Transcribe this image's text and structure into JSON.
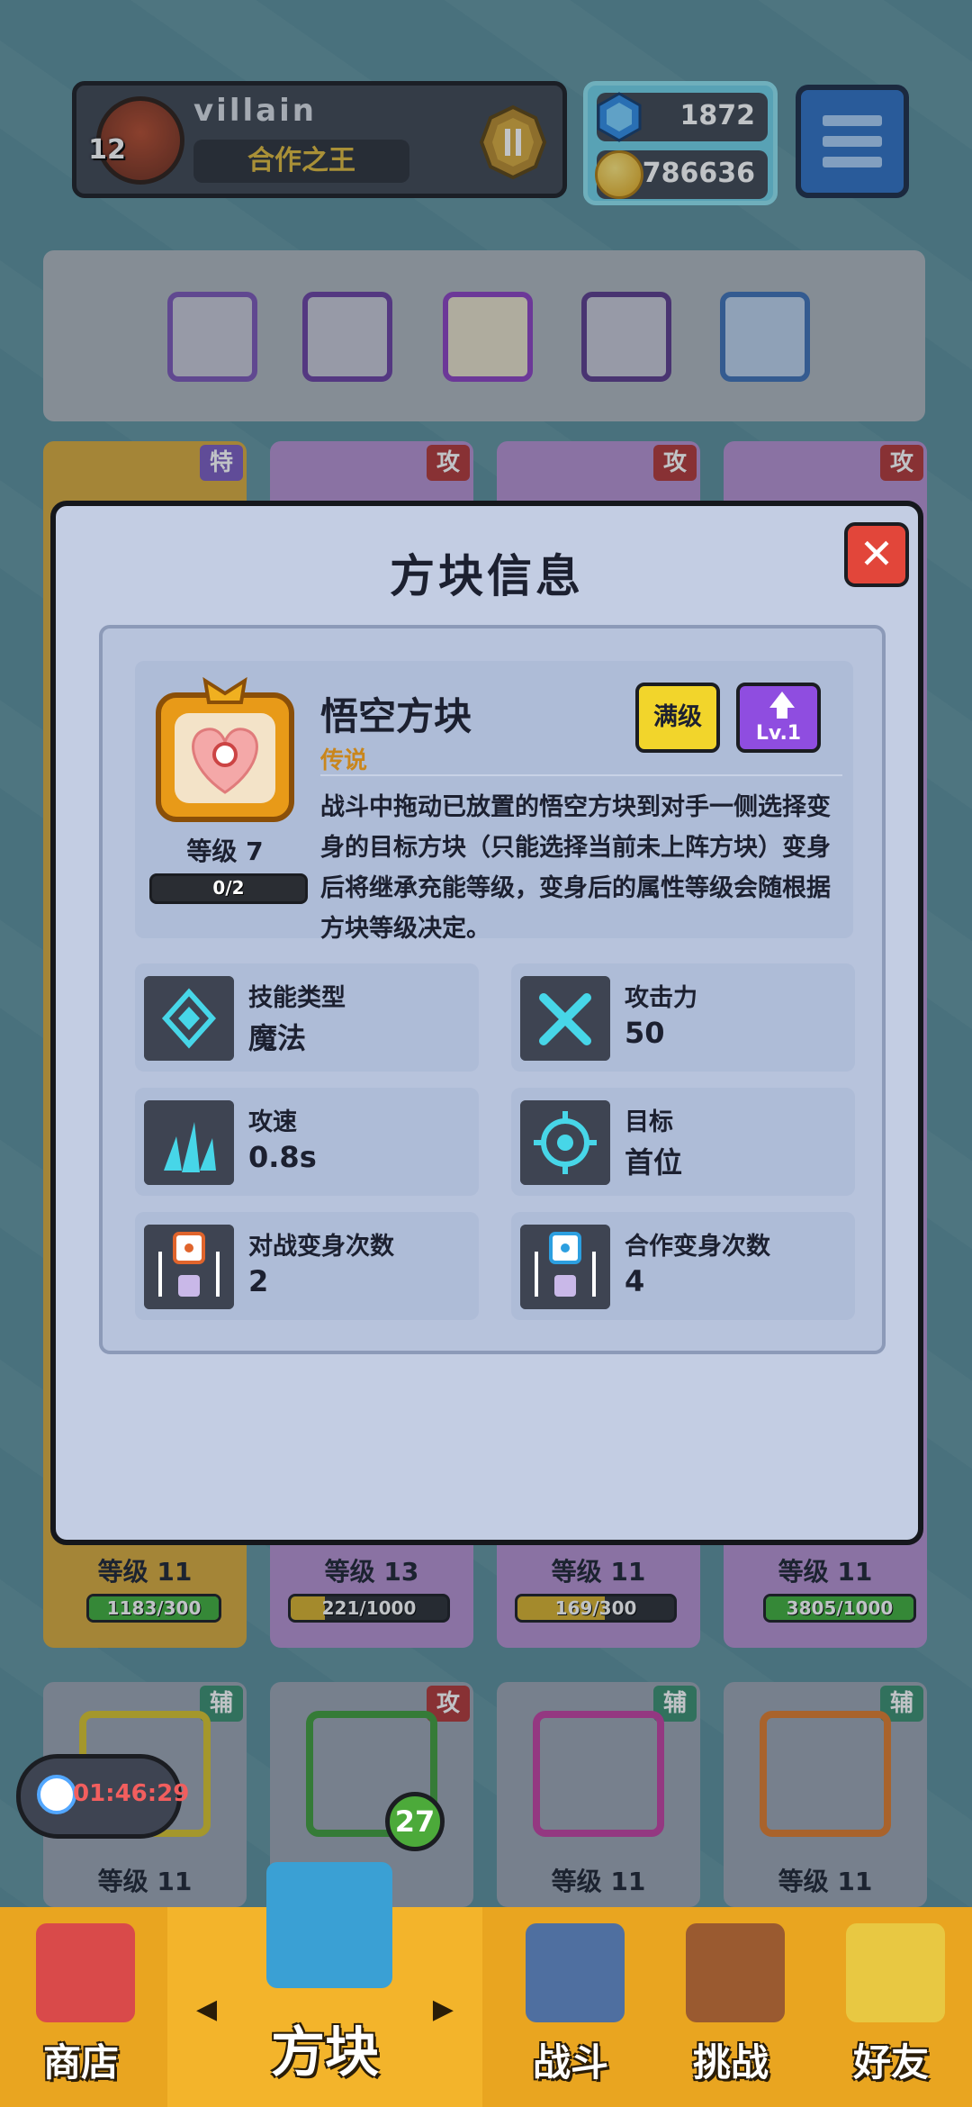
{
  "profile": {
    "username": "villain",
    "level": "12",
    "title": "合作之王",
    "rank_icon": "rank-roman-ii-icon"
  },
  "currency": {
    "gems": "1872",
    "coins": "786636"
  },
  "background_cards": {
    "row1_tags": [
      "特",
      "攻",
      "攻",
      "攻"
    ],
    "row1_levels": [
      "等级 11",
      "等级 13",
      "等级 11",
      "等级 11"
    ],
    "row1_progress": [
      "1183/300",
      "221/1000",
      "169/300",
      "3805/1000"
    ],
    "row2_tags": [
      "辅",
      "攻",
      "辅",
      "辅"
    ],
    "row2_levels": [
      "等级 11",
      "",
      "等级 11",
      "等级 11"
    ]
  },
  "modal": {
    "title": "方块信息",
    "close_label": "✕",
    "block": {
      "name": "悟空方块",
      "rarity": "传说",
      "level_label": "等级 7",
      "progress": "0/2",
      "max_button": "满级",
      "level_button": "Lv.1",
      "description": "战斗中拖动已放置的悟空方块到对手一侧选择变身的目标方块（只能选择当前未上阵方块）变身后将继承充能等级，变身后的属性等级会随根据方块等级决定。"
    },
    "stats": [
      {
        "label": "技能类型",
        "value": "魔法",
        "icon": "skill-type-icon"
      },
      {
        "label": "攻击力",
        "value": "50",
        "icon": "crossed-swords-icon"
      },
      {
        "label": "攻速",
        "value": "0.8s",
        "icon": "attack-speed-icon"
      },
      {
        "label": "目标",
        "value": "首位",
        "icon": "target-icon"
      },
      {
        "label": "对战变身次数",
        "value": "2",
        "icon": "transform-battle-icon"
      },
      {
        "label": "合作变身次数",
        "value": "4",
        "icon": "transform-coop-icon"
      }
    ]
  },
  "timer": "01:46:29",
  "dice_badge": "27",
  "nav": {
    "shop": "商店",
    "blocks": "方块",
    "battle": "战斗",
    "challenge": "挑战",
    "friends": "好友"
  },
  "colors": {
    "modal_bg": "#c3cde3",
    "close_button": "#e2463a",
    "max_button": "#f2d52b",
    "level_button": "#8f4de0",
    "rarity_text": "#c9861c",
    "nav_bg": "#e9a520"
  }
}
